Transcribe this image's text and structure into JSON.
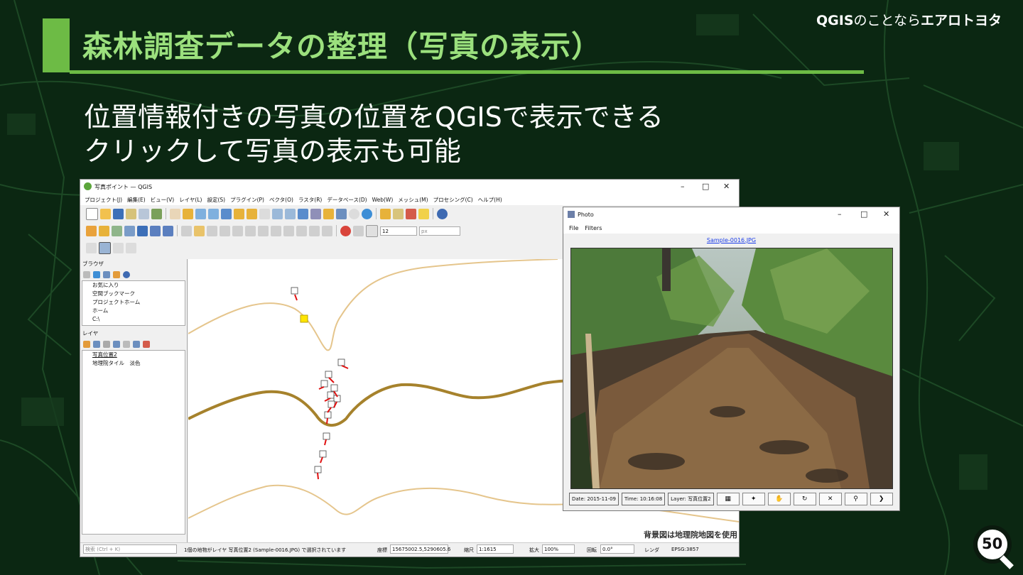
{
  "slide": {
    "brand": {
      "name": "QGIS",
      "mid": "のことなら",
      "company": "エアロトヨタ"
    },
    "title": "森林調査データの整理（写真の表示）",
    "bullets": [
      "位置情報付きの写真の位置をQGISで表示できる",
      "クリックして写真の表示も可能"
    ],
    "page_number": "50"
  },
  "qgis": {
    "window_title": "写真ポイント — QGIS",
    "window_controls": [
      "–",
      "□",
      "✕"
    ],
    "menu": [
      "プロジェクト(J)",
      "編集(E)",
      "ビュー(V)",
      "レイヤ(L)",
      "設定(S)",
      "プラグイン(P)",
      "ベクタ(O)",
      "ラスタ(R)",
      "データベース(D)",
      "Web(W)",
      "メッシュ(M)",
      "プロセシング(C)",
      "ヘルプ(H)"
    ],
    "snap_value": "12",
    "snap_unit": "px",
    "browser": {
      "title": "ブラウザ",
      "items": [
        "お気に入り",
        "空間ブックマーク",
        "プロジェクトホーム",
        "ホーム",
        "C:\\"
      ]
    },
    "layers": {
      "title": "レイヤ",
      "items": [
        "写真位置2",
        "地理院タイル　淡色"
      ]
    },
    "attribution": "背景図は地理院地図を使用",
    "status": {
      "search_placeholder": "検索 (Ctrl + K)",
      "message": "1個の地物がレイヤ 写真位置2 (Sample-0016.JPG) で選択されています",
      "coord_label": "座標",
      "coord_value": "15675002.5,5290605.6",
      "scale_label": "縮尺",
      "scale_value": "1:1615",
      "zoom_label": "拡大",
      "zoom_value": "100%",
      "rotation_label": "回転",
      "rotation_value": "0.0°",
      "render_label": "レンダ",
      "crs": "EPSG:3857"
    }
  },
  "photo": {
    "window_title": "Photo",
    "window_controls": [
      "–",
      "□",
      "✕"
    ],
    "menu": [
      "File",
      "Filters"
    ],
    "filename": "Sample-0016.JPG",
    "date": "Date: 2015-11-09",
    "time": "Time: 10:16:08",
    "layer": "Layer: 写真位置2"
  }
}
